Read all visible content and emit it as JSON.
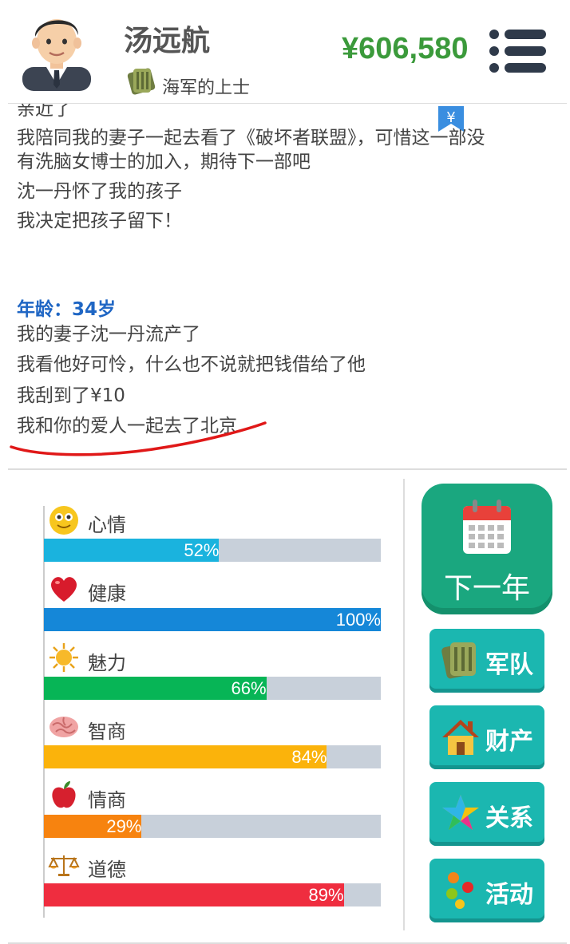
{
  "header": {
    "name": "汤远航",
    "rank": "海军的上士",
    "money": "¥606,580",
    "avatar_icon": "avatar-man-suit",
    "rank_icon": "military-badge-icon",
    "menu_icon": "hamburger-menu-icon"
  },
  "log": {
    "lines_before": [
      "亲近了",
      "我陪同我的妻子一起去看了《破坏者联盟》，可惜这一部没",
      "有洗脑女博士的加入，期待下一部吧",
      "沈一丹怀了我的孩子",
      "我决定把孩子留下！"
    ],
    "age_title": "年龄：34岁",
    "age_lines": [
      "我的妻子沈一丹流产了",
      "我看他好可怜，什么也不说就把钱借给了他",
      "我刮到了¥10",
      "我和你的爱人一起去了北京"
    ],
    "bookmark_symbol": "¥"
  },
  "stats": [
    {
      "label": "心情",
      "value": 52,
      "text": "52%",
      "color": "#1ab3de",
      "icon": "smiley-face-icon"
    },
    {
      "label": "健康",
      "value": 100,
      "text": "100%",
      "color": "#1587d8",
      "icon": "heart-icon"
    },
    {
      "label": "魅力",
      "value": 66,
      "text": "66%",
      "color": "#07b556",
      "icon": "sun-icon"
    },
    {
      "label": "智商",
      "value": 84,
      "text": "84%",
      "color": "#fbb30b",
      "icon": "brain-icon"
    },
    {
      "label": "情商",
      "value": 29,
      "text": "29%",
      "color": "#f7830f",
      "icon": "apple-icon"
    },
    {
      "label": "道德",
      "value": 89,
      "text": "89%",
      "color": "#ef2d3f",
      "icon": "scales-icon"
    }
  ],
  "buttons": {
    "next_year": "下一年",
    "army": "军队",
    "property": "财产",
    "relations": "关系",
    "activities": "活动"
  },
  "colors": {
    "money": "#3b9a3b",
    "age_title": "#1f66c4",
    "next_year_bg": "#1aa77f",
    "side_btn_bg": "#1bb7b0",
    "bar_track": "#c8d0da"
  }
}
